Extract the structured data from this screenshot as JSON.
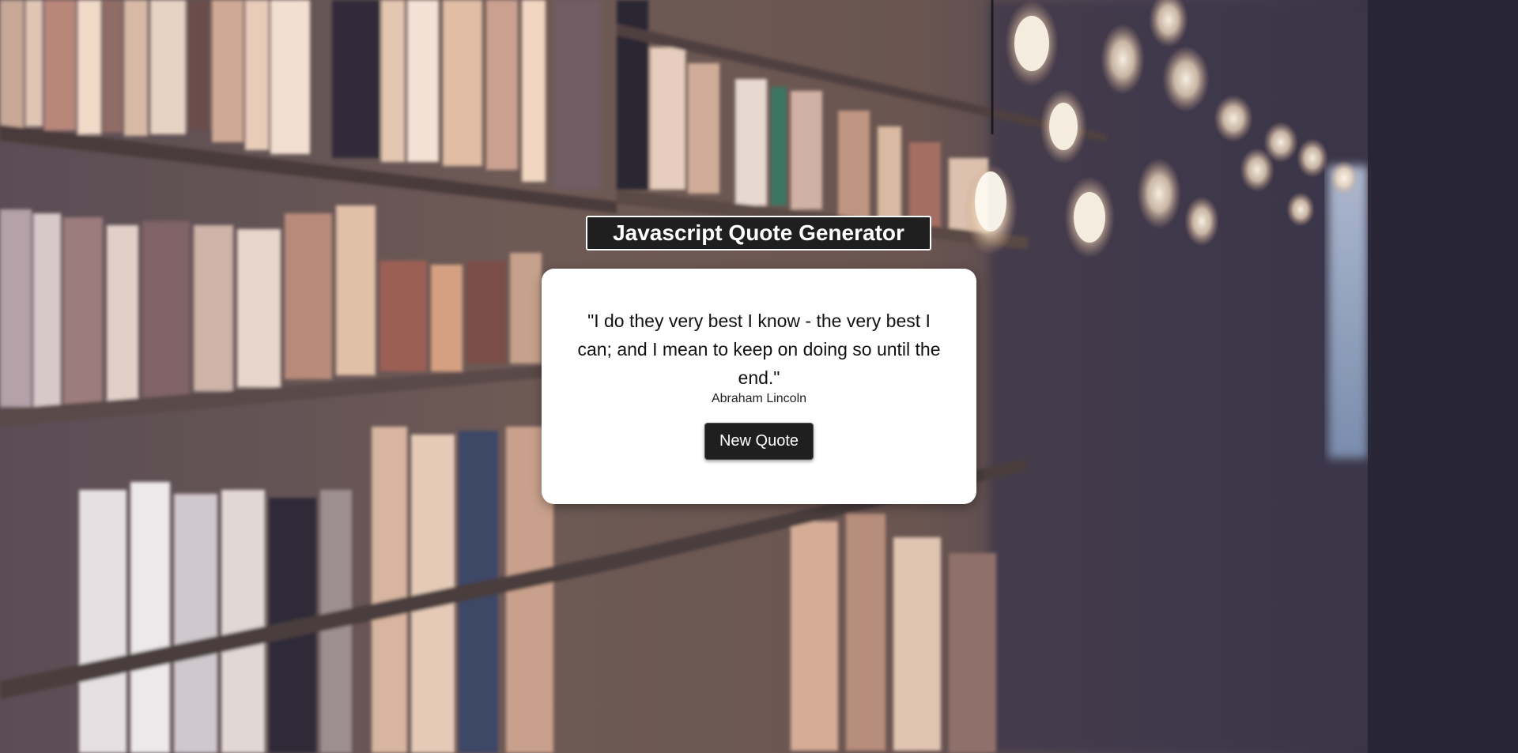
{
  "header": {
    "title": "Javascript Quote Generator"
  },
  "quote": {
    "text": "\"I do they very best I know - the very best I can; and I mean to keep on doing so until the end.\"",
    "author": "Abraham Lincoln"
  },
  "actions": {
    "new_quote_label": "New Quote"
  },
  "colors": {
    "title_bg": "#1f1f1f",
    "card_bg": "#ffffff",
    "button_bg": "#1f1f1f"
  }
}
